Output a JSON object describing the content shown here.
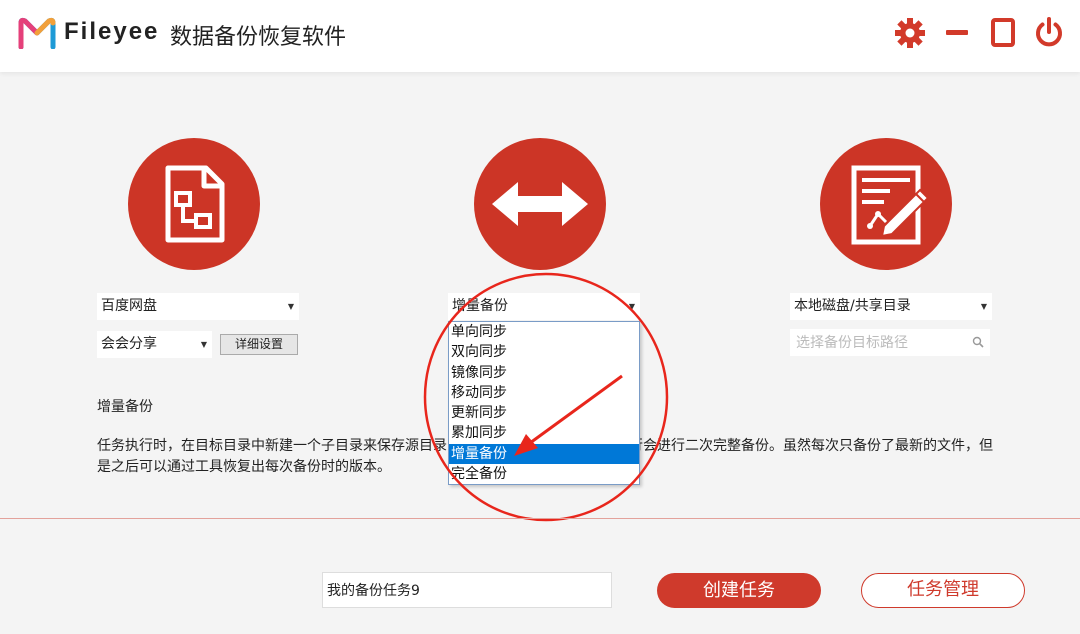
{
  "header": {
    "brand": "Fileyee",
    "title": "数据备份恢复软件",
    "logo_icon": "fileyee-logo-icon",
    "settings_icon": "gear-icon",
    "minimize_icon": "minimize-icon",
    "maximize_icon": "maximize-icon",
    "power_icon": "power-icon"
  },
  "source": {
    "icon": "document-flowchart-icon",
    "provider": "百度网盘",
    "account": "会会分享",
    "detail_button": "详细设置"
  },
  "mode": {
    "icon": "double-arrow-icon",
    "selected": "增量备份",
    "options": [
      "单向同步",
      "双向同步",
      "镜像同步",
      "移动同步",
      "更新同步",
      "累加同步",
      "增量备份",
      "完全备份"
    ]
  },
  "target": {
    "icon": "edit-document-icon",
    "type": "本地磁盘/共享目录",
    "path_placeholder": "选择备份目标路径",
    "search_icon": "search-icon"
  },
  "description": {
    "title": "增量备份",
    "text": "任务执行时，在目标目录中新建一个子目录来保存源目录中新增及修改的文件，首次执行会进行二次完整备份。虽然每次只备份了最新的文件，但是之后可以通过工具恢复出每次备份时的版本。"
  },
  "footer": {
    "task_name": "我的备份任务9",
    "create_button": "创建任务",
    "manage_button": "任务管理"
  },
  "colors": {
    "accent": "#cc3526",
    "selection": "#0078d7",
    "annotation": "#e8261c"
  }
}
